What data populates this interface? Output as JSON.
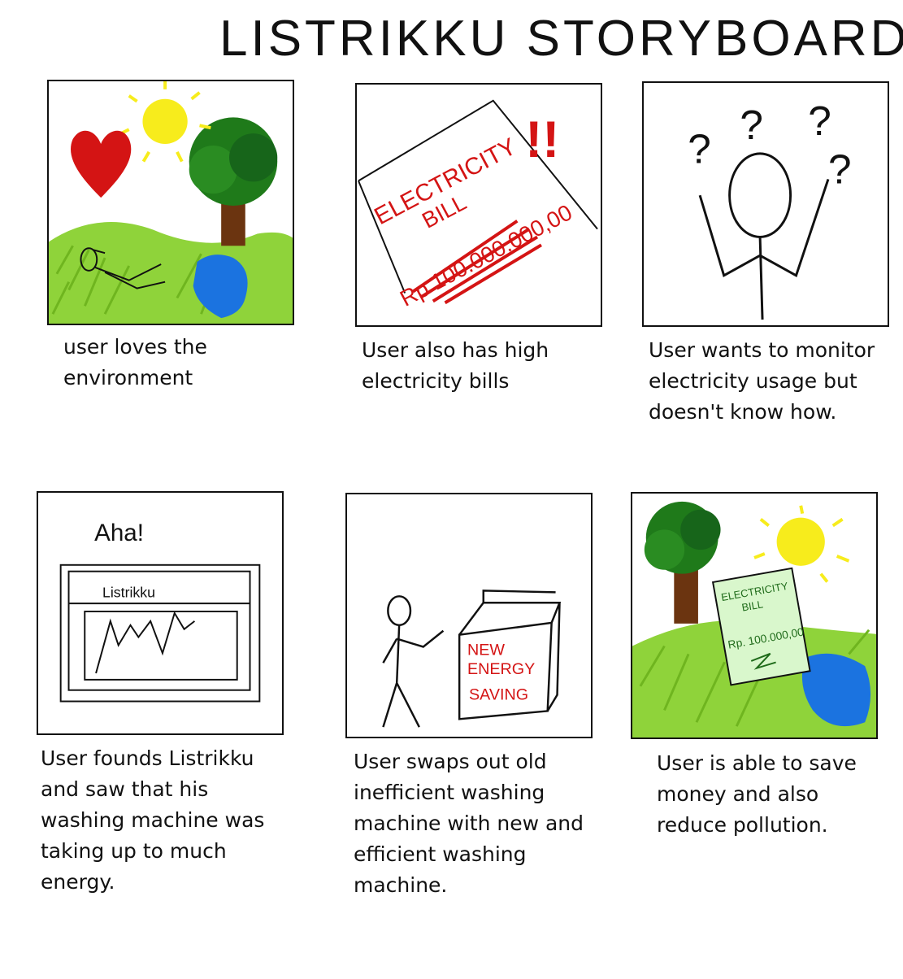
{
  "title": "LISTRIKKU STORYBOARD",
  "panels": [
    {
      "caption": "user loves the environment"
    },
    {
      "caption": "User also has high electricity bills",
      "bill_heading_line1": "ELECTRICITY",
      "bill_heading_line2": "BILL",
      "bill_amount": "Rp 100.000.000,00",
      "alert": "!!"
    },
    {
      "caption": "User wants to monitor electricity usage but doesn't know how."
    },
    {
      "caption": "User founds Listrikku and saw that his washing machine was taking up to much energy.",
      "exclamation": "Aha!",
      "app_name": "Listrikku"
    },
    {
      "caption": "User swaps out old inefficient washing machine with new and efficient washing machine.",
      "machine_label_line1": "NEW",
      "machine_label_line2": "ENERGY",
      "machine_label_line3": "SAVING"
    },
    {
      "caption": "User is able to save money and also reduce pollution.",
      "bill_heading_line1": "ELECTRICITY",
      "bill_heading_line2": "BILL",
      "bill_amount": "Rp. 100.000,00"
    }
  ],
  "colors": {
    "red": "#d41414",
    "green": "#7cc42a",
    "dark_green": "#1f6b1a",
    "blue": "#1b73e0",
    "yellow": "#f7ec1c",
    "brown": "#6b3410"
  }
}
